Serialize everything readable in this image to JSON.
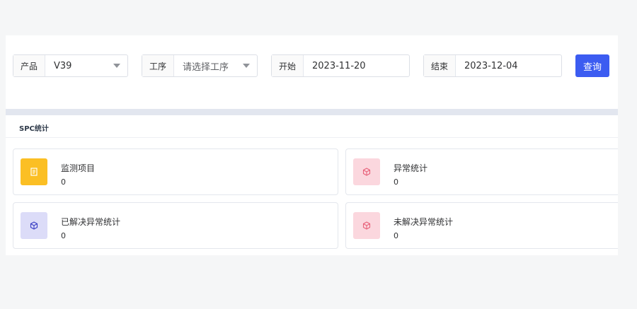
{
  "filters": {
    "product": {
      "label": "产品",
      "value": "V39"
    },
    "process": {
      "label": "工序",
      "placeholder": "请选择工序"
    },
    "start": {
      "label": "开始",
      "value": "2023-11-20"
    },
    "end": {
      "label": "结束",
      "value": "2023-12-04"
    },
    "query_label": "查询"
  },
  "stats": {
    "section_title": "SPC统计",
    "cards": [
      {
        "title": "监测项目",
        "count": "0",
        "icon": "document-icon",
        "color": "#fbbf24"
      },
      {
        "title": "异常统计",
        "count": "0",
        "icon": "cube-icon",
        "color": "#fbd7de"
      },
      {
        "title": "已解决异常统计",
        "count": "0",
        "icon": "cube-icon",
        "color": "#dcdcf8"
      },
      {
        "title": "未解决异常统计",
        "count": "0",
        "icon": "cube-icon",
        "color": "#fbd7de"
      }
    ]
  }
}
